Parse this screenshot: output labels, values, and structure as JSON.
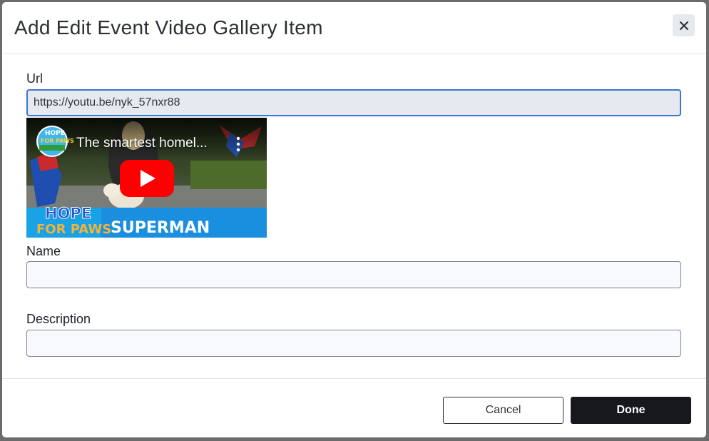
{
  "dialog": {
    "title": "Add Edit Event Video Gallery Item",
    "close_icon": "close-icon"
  },
  "form": {
    "url": {
      "label": "Url",
      "value": "https://youtu.be/nyk_57nxr88"
    },
    "name": {
      "label": "Name",
      "value": ""
    },
    "description": {
      "label": "Description",
      "value": ""
    }
  },
  "video": {
    "title": "The smartest homel...",
    "channel_logo_text": [
      "HOPE",
      "FOR PAWS"
    ],
    "banner_left": [
      "HOPE",
      "FOR PAWS"
    ],
    "banner_right": "SUPERMAN",
    "play_icon": "play-icon",
    "menu_icon": "more-vertical-icon"
  },
  "footer": {
    "cancel_label": "Cancel",
    "done_label": "Done"
  },
  "colors": {
    "primary": "#16181d",
    "focus_border": "#3a77d0",
    "youtube_red": "#ff0000"
  }
}
